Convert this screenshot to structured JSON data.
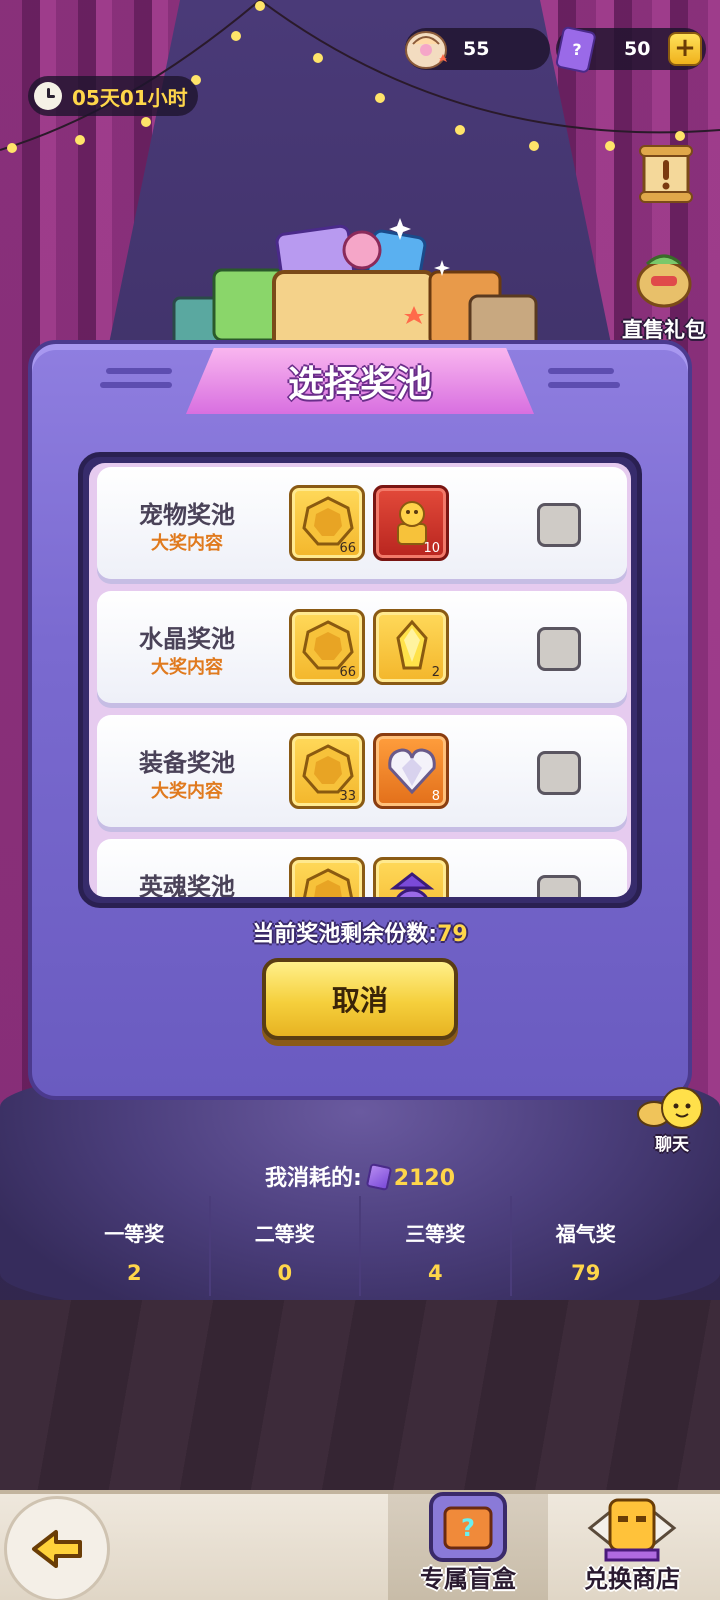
{
  "timer": {
    "text": "05天01小时",
    "icon": "clock-icon"
  },
  "currencies": [
    {
      "icon": "shell-icon",
      "value": "55"
    },
    {
      "icon": "ticket-icon",
      "value": "50",
      "plus": "+"
    }
  ],
  "side_buttons": {
    "notice": {
      "icon": "scroll-notice-icon"
    },
    "gift": {
      "icon": "gift-bag-icon",
      "label": "直售礼包"
    }
  },
  "panel": {
    "title": "选择奖池",
    "pools": [
      {
        "name": "宠物奖池",
        "sub": "大奖内容",
        "items": [
          {
            "icon": "gold-token-icon",
            "count": "66",
            "style": "gold"
          },
          {
            "icon": "golden-pet-icon",
            "count": "10",
            "style": "red"
          }
        ]
      },
      {
        "name": "水晶奖池",
        "sub": "大奖内容",
        "items": [
          {
            "icon": "gold-token-icon",
            "count": "66",
            "style": "gold"
          },
          {
            "icon": "crystal-icon",
            "count": "2",
            "style": "gold"
          }
        ]
      },
      {
        "name": "装备奖池",
        "sub": "大奖内容",
        "items": [
          {
            "icon": "gold-token-icon",
            "count": "33",
            "style": "gold"
          },
          {
            "icon": "diamond-heart-icon",
            "count": "8",
            "style": "orange"
          }
        ]
      },
      {
        "name": "英魂奖池",
        "sub": "",
        "items": [
          {
            "icon": "gold-token-icon",
            "count": "",
            "style": "gold"
          },
          {
            "icon": "hero-soul-icon",
            "count": "",
            "style": "gold"
          }
        ]
      }
    ],
    "remain_label": "当前奖池剩余份数:",
    "remain_value": "79",
    "cancel_label": "取消"
  },
  "chat": {
    "label": "聊天",
    "icon": "chat-bubble-icon"
  },
  "consume": {
    "label": "我消耗的:",
    "icon": "ticket-icon",
    "value": "2120"
  },
  "stats": [
    {
      "label": "一等奖",
      "value": "2"
    },
    {
      "label": "二等奖",
      "value": "0"
    },
    {
      "label": "三等奖",
      "value": "4"
    },
    {
      "label": "福气奖",
      "value": "79"
    }
  ],
  "bottom": {
    "back_icon": "back-arrow-icon",
    "tabs": [
      {
        "label": "专属盲盒",
        "icon": "mystery-box-icon",
        "active": true
      },
      {
        "label": "兑换商店",
        "icon": "shop-totem-icon",
        "active": false
      }
    ]
  },
  "colors": {
    "accent_gold": "#ffd64a",
    "panel_purple": "#7a6ad0",
    "title_pink": "#d86fe0",
    "sub_orange": "#e07a1e"
  }
}
